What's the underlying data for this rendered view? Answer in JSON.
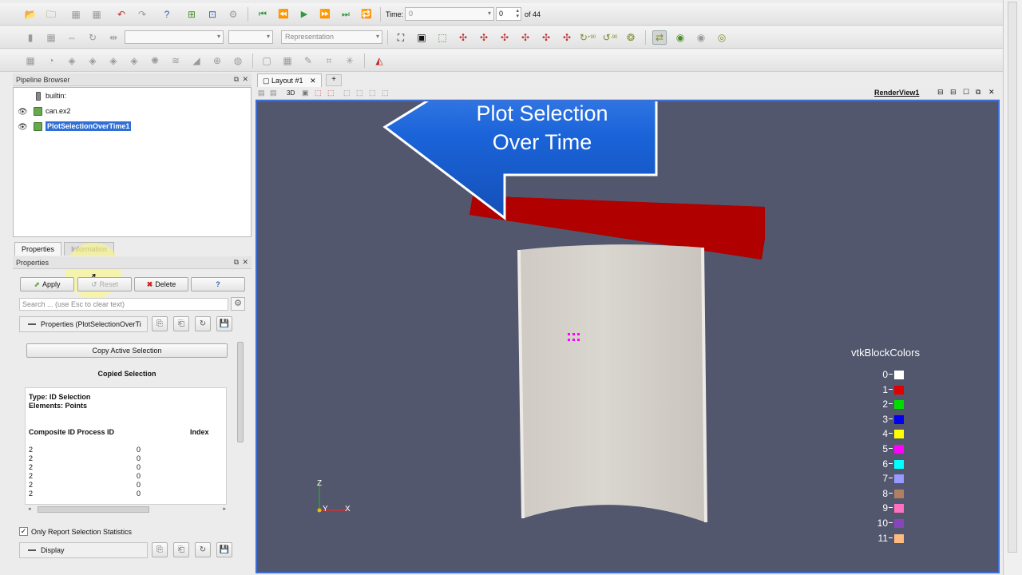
{
  "toolbar": {
    "time_label": "Time:",
    "time_value": "0",
    "timestep_value": "0",
    "timestep_total": "of 44",
    "representation_placeholder": "Representation",
    "rotate_plus_label": "+90",
    "rotate_minus_label": "-90"
  },
  "pipeline": {
    "title": "Pipeline Browser",
    "items": [
      {
        "label": "builtin:"
      },
      {
        "label": "can.ex2"
      },
      {
        "label": "PlotSelectionOverTime1"
      }
    ]
  },
  "tabs": {
    "properties": "Properties",
    "information": "Information"
  },
  "properties": {
    "title": "Properties",
    "apply_label": "Apply",
    "reset_label": "Reset",
    "delete_label": "Delete",
    "help_label": "?",
    "search_placeholder": "Search ... (use Esc to clear text)",
    "section_label": "Properties (PlotSelectionOverTi",
    "copy_button_label": "Copy Active Selection",
    "copied_heading": "Copied Selection",
    "selection_type": "Type: ID Selection",
    "selection_elements": "Elements: Points",
    "columns": [
      "Composite ID Process ID",
      "Index"
    ],
    "rows": [
      [
        "2",
        "0"
      ],
      [
        "2",
        "0"
      ],
      [
        "2",
        "0"
      ],
      [
        "2",
        "0"
      ],
      [
        "2",
        "0"
      ],
      [
        "2",
        "0"
      ]
    ],
    "only_stats_label": "Only Report Selection Statistics",
    "display_section": "Display"
  },
  "layout": {
    "tab_label": "Layout #1",
    "add_tab": "+",
    "view_name": "RenderView1",
    "mode_3d": "3D"
  },
  "callout": {
    "line1": "Plot Selection",
    "line2": "Over Time"
  },
  "axes": {
    "z": "Z",
    "y": "Y",
    "x": "X"
  },
  "legend": {
    "title": "vtkBlockColors",
    "entries": [
      {
        "label": "0",
        "color": "#ffffff"
      },
      {
        "label": "1",
        "color": "#e00000"
      },
      {
        "label": "2",
        "color": "#00dd00"
      },
      {
        "label": "3",
        "color": "#0000ee"
      },
      {
        "label": "4",
        "color": "#ffff00"
      },
      {
        "label": "5",
        "color": "#ff00ff"
      },
      {
        "label": "6",
        "color": "#00ffff"
      },
      {
        "label": "7",
        "color": "#9999ff"
      },
      {
        "label": "8",
        "color": "#b08060"
      },
      {
        "label": "9",
        "color": "#ff70c0"
      },
      {
        "label": "10",
        "color": "#8844bb"
      },
      {
        "label": "11",
        "color": "#ffbb80"
      }
    ]
  },
  "colors": {
    "render_background": "#52576e",
    "selection_highlight": "#2f6fd6",
    "callout_blue": "#1a63d8",
    "bar_red": "#b00000",
    "can_surface": "#d6d2cc",
    "selected_points": "#ff00ff"
  }
}
